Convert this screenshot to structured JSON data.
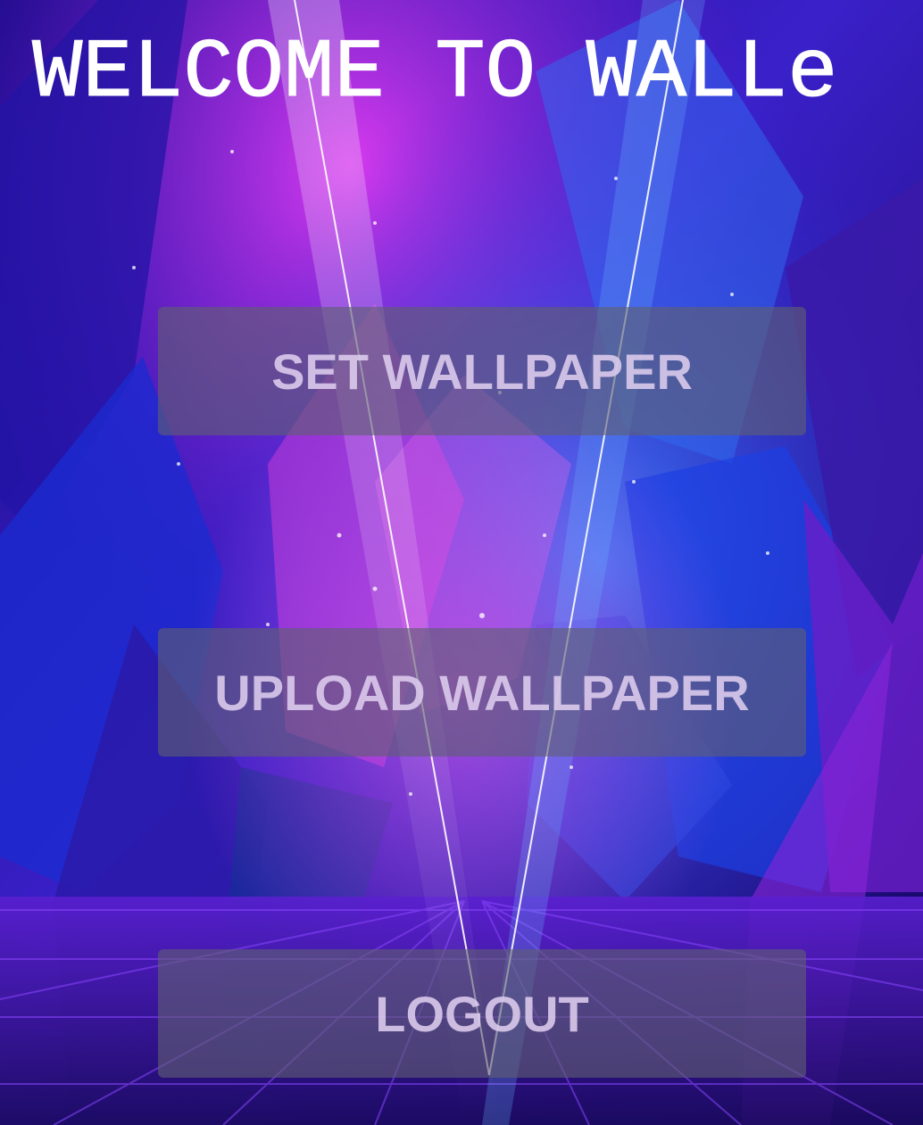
{
  "header": {
    "title": "WELCOME TO WALLe"
  },
  "buttons": {
    "set_wallpaper": "SET WALLPAPER",
    "upload_wallpaper": "UPLOAD WALLPAPER",
    "logout": "LOGOUT"
  },
  "colors": {
    "background_deep": "#1a0a6e",
    "background_blue": "#2b3cd8",
    "background_magenta": "#c42cd8",
    "button_fill": "#5f5f73",
    "button_text": "#decdee",
    "title_text": "#ffffff"
  }
}
